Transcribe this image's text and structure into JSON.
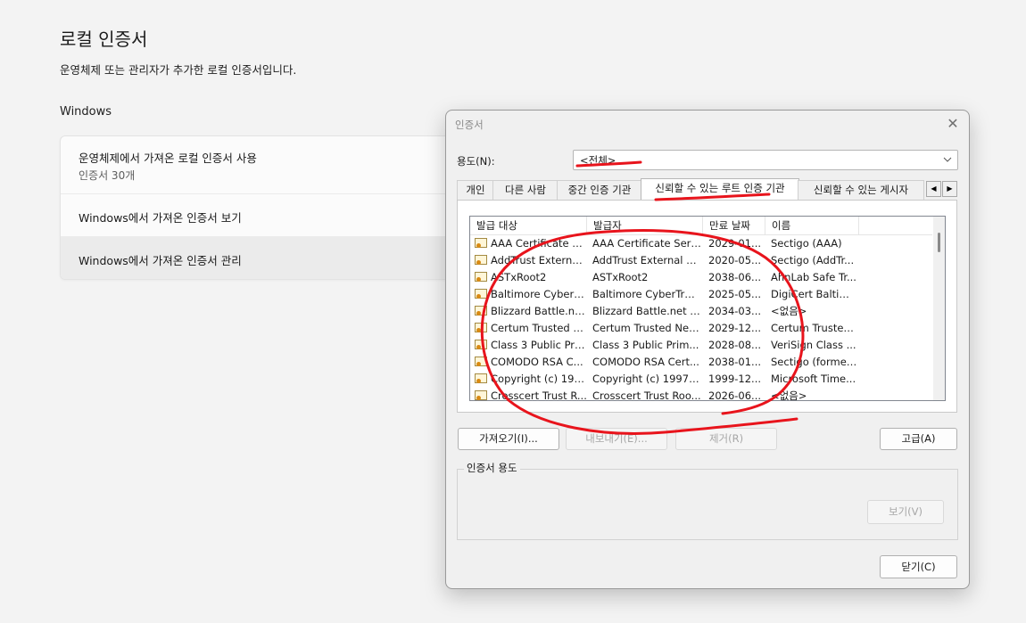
{
  "page": {
    "title": "로컬 인증서",
    "description": "운영체제 또는 관리자가 추가한 로컬 인증서입니다.",
    "section": "Windows"
  },
  "card": {
    "row1_title": "운영체제에서 가져온 로컬 인증서 사용",
    "row1_sub": "인증서 30개",
    "row2_title": "Windows에서 가져온 인증서 보기",
    "row3_title": "Windows에서 가져온 인증서 관리"
  },
  "dialog": {
    "title": "인증서",
    "close_glyph": "✕",
    "purpose_label": "용도(N):",
    "purpose_value": "<전체>",
    "tabs": [
      "개인",
      "다른 사람",
      "중간 인증 기관",
      "신뢰할 수 있는 루트 인증 기관",
      "신뢰할 수 있는 게시자"
    ],
    "active_tab": 3,
    "columns": [
      "발급 대상",
      "발급자",
      "만료 날짜",
      "이름"
    ],
    "rows": [
      [
        "AAA Certificate S...",
        "AAA Certificate Serv...",
        "2029-01...",
        "Sectigo (AAA)"
      ],
      [
        "AddTrust External...",
        "AddTrust External C...",
        "2020-05...",
        "Sectigo (AddTr..."
      ],
      [
        "ASTxRoot2",
        "ASTxRoot2",
        "2038-06...",
        "AhnLab Safe Tr..."
      ],
      [
        "Baltimore CyberTr...",
        "Baltimore CyberTrus...",
        "2025-05...",
        "DigiCert Baltim..."
      ],
      [
        "Blizzard Battle.net...",
        "Blizzard Battle.net L...",
        "2034-03...",
        "<없음>"
      ],
      [
        "Certum Trusted N...",
        "Certum Trusted Net...",
        "2029-12...",
        "Certum Trusted..."
      ],
      [
        "Class 3 Public Pri...",
        "Class 3 Public Prim...",
        "2028-08...",
        "VeriSign Class ..."
      ],
      [
        "COMODO RSA C...",
        "COMODO RSA Cert...",
        "2038-01...",
        "Sectigo (former..."
      ],
      [
        "Copyright (c) 199...",
        "Copyright (c) 1997 ...",
        "1999-12...",
        "Microsoft Time..."
      ],
      [
        "Crosscert Trust R...",
        "Crosscert Trust Roo...",
        "2026-06...",
        "<없음>"
      ]
    ],
    "import_label": "가져오기(I)...",
    "export_label": "내보내기(E)...",
    "remove_label": "제거(R)",
    "advanced_label": "고급(A)",
    "purposes_group_label": "인증서 용도",
    "view_label": "보기(V)",
    "close_label": "닫기(C)"
  },
  "annotation_color": "#e8141c"
}
